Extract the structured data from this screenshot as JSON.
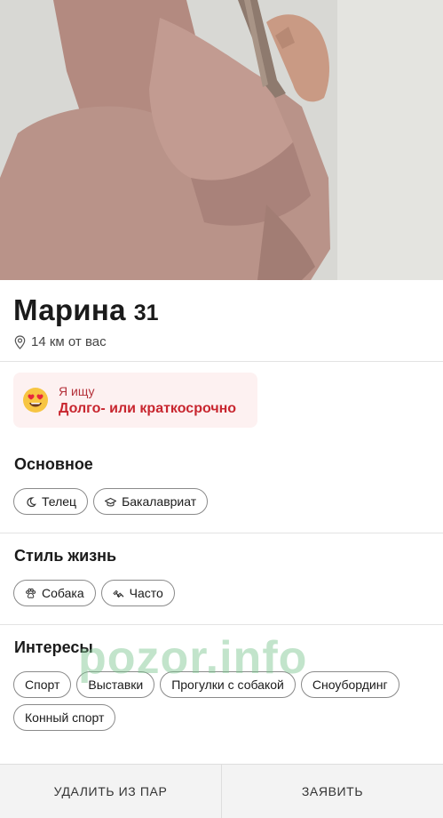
{
  "profile": {
    "name": "Марина",
    "age": "31",
    "distance": "14 км от вас"
  },
  "looking_for": {
    "label": "Я ищу",
    "value": "Долго- или краткосрочно",
    "emoji": "heart-eyes"
  },
  "basics": {
    "title": "Основное",
    "chips": [
      {
        "icon": "moon-icon",
        "label": "Телец"
      },
      {
        "icon": "graduation-cap-icon",
        "label": "Бакалавриат"
      }
    ]
  },
  "lifestyle": {
    "title": "Стиль жизнь",
    "chips": [
      {
        "icon": "paw-icon",
        "label": "Собака"
      },
      {
        "icon": "dumbbell-icon",
        "label": "Часто"
      }
    ]
  },
  "interests": {
    "title": "Интересы",
    "chips": [
      {
        "label": "Спорт"
      },
      {
        "label": "Выставки"
      },
      {
        "label": "Прогулки с собакой"
      },
      {
        "label": "Сноубординг"
      },
      {
        "label": "Конный спорт"
      }
    ]
  },
  "watermark": "pozor.info",
  "actions": {
    "remove_label": "Удалить из пар",
    "report_label": "Заявить"
  },
  "colors": {
    "accent": "#c8262f",
    "seek_bg": "#fdf1f1",
    "hoodie": "#b89086"
  }
}
